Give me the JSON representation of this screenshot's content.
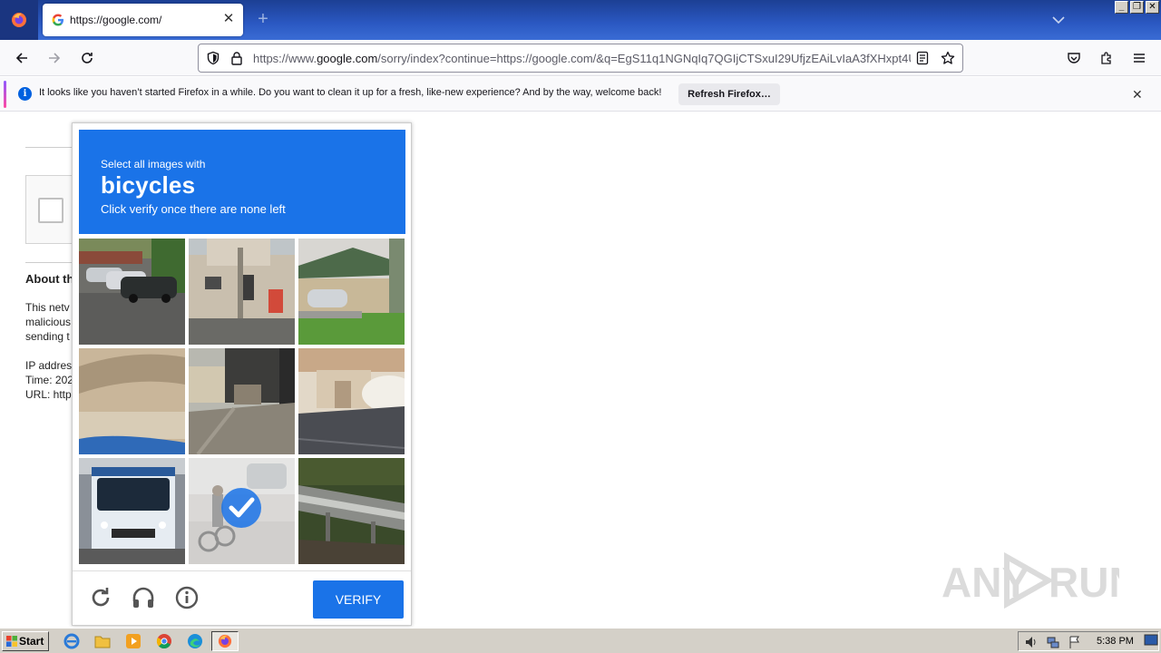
{
  "browser": {
    "tab": {
      "title": "https://google.com/"
    },
    "url": {
      "prefix": "https://www.",
      "domain": "google.com",
      "rest": "/sorry/index?continue=https://google.com/&q=EgS11q1NGNqIq7QGIjCTSxuI29UfjzEAiLvIaA3fXHxpt4Ul"
    },
    "notification": {
      "message": "It looks like you haven’t started Firefox in a while. Do you want to clean it up for a fresh, like-new experience? And by the way, welcome back!",
      "button_label": "Refresh Firefox…"
    }
  },
  "background_page": {
    "heading_fragment": "About th",
    "lines": [
      "This netv",
      "malicious",
      "sending t"
    ],
    "ip_line": "IP addres",
    "time_line": "Time: 202",
    "url_line": "URL: http"
  },
  "captcha": {
    "instruction_top": "Select all images with",
    "target": "bicycles",
    "instruction_bottom": "Click verify once there are none left",
    "verify_label": "VERIFY",
    "tiles": [
      {
        "scene": "parked-cars",
        "selected": false
      },
      {
        "scene": "house-pole",
        "selected": false
      },
      {
        "scene": "garage-car",
        "selected": false
      },
      {
        "scene": "dirt-road",
        "selected": false
      },
      {
        "scene": "street-buildings",
        "selected": false
      },
      {
        "scene": "shed-road",
        "selected": false
      },
      {
        "scene": "bus",
        "selected": false
      },
      {
        "scene": "bicycle-rider",
        "selected": true
      },
      {
        "scene": "guardrail",
        "selected": false
      }
    ]
  },
  "watermark": {
    "text": "ANY RUN"
  },
  "taskbar": {
    "start_label": "Start",
    "clock": "5:38 PM"
  },
  "colors": {
    "captcha_blue": "#1a73e8",
    "taskbar_gray": "#d4d0c8",
    "titlebar_blue": "#2b59c3"
  }
}
